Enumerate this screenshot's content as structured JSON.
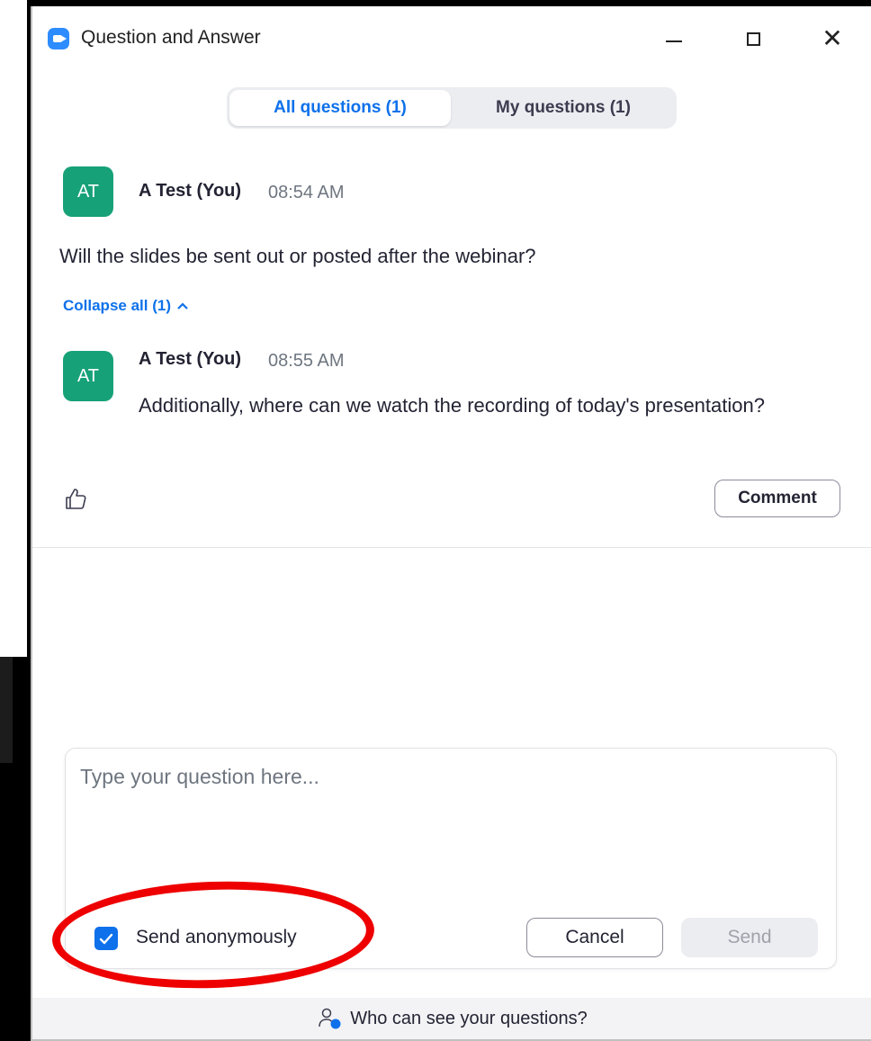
{
  "window": {
    "title": "Question and Answer"
  },
  "tabs": [
    {
      "label": "All questions (1)",
      "active": true
    },
    {
      "label": "My questions (1)",
      "active": false
    }
  ],
  "question": {
    "avatar_initials": "AT",
    "author": "A Test (You)",
    "time": "08:54 AM",
    "text": "Will the slides be sent out or posted after the webinar?"
  },
  "collapse_label": "Collapse all (1)",
  "reply": {
    "avatar_initials": "AT",
    "author": "A Test (You)",
    "time": "08:55 AM",
    "text": "Additionally, where can we watch the recording of today's presentation?"
  },
  "actions": {
    "comment_label": "Comment"
  },
  "composer": {
    "placeholder": "Type your question here...",
    "anonymous_label": "Send anonymously",
    "anonymous_checked": true,
    "cancel_label": "Cancel",
    "send_label": "Send"
  },
  "footer": {
    "label": "Who can see your questions?"
  },
  "colors": {
    "accent": "#0e71eb",
    "avatar": "#17a178",
    "highlight": "#ee0000"
  },
  "icons": [
    "zoom-app-icon",
    "minimize-icon",
    "maximize-icon",
    "close-icon",
    "chevron-up-icon",
    "thumbs-up-icon",
    "checkmark-icon",
    "people-info-icon"
  ]
}
